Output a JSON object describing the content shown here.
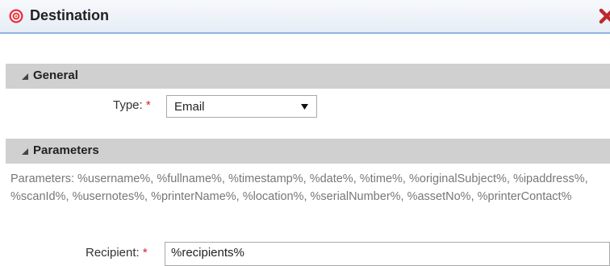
{
  "dialog": {
    "title": "Destination",
    "icon": "target-icon",
    "close_icon": "close-x-icon",
    "accent_color": "#d01f2d"
  },
  "general": {
    "header": "General",
    "type_label": "Type:",
    "required_mark": "*",
    "type_value": "Email"
  },
  "parameters": {
    "header": "Parameters",
    "description": "Parameters: %username%, %fullname%, %timestamp%, %date%, %time%, %originalSubject%, %ipaddress%, %scanId%, %usernotes%, %printerName%, %location%, %serialNumber%, %assetNo%, %printerContact%",
    "recipient_label": "Recipient:",
    "required_mark": "*",
    "recipient_value": "%recipients%"
  }
}
